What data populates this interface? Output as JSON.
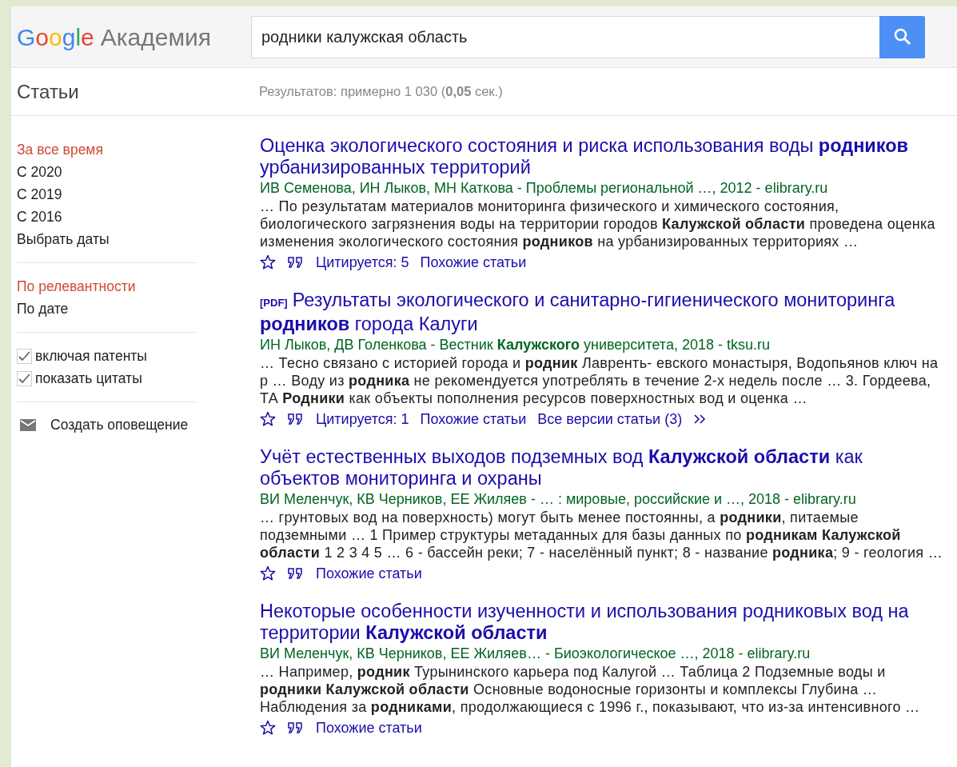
{
  "header": {
    "logo": "Google",
    "product": "Академия",
    "search": {
      "value": "родники калужская область"
    }
  },
  "section_title": "Статьи",
  "result_stats": "Результатов: примерно 1 030 (**0,05** сек.)",
  "sidebar": {
    "time_filters": [
      {
        "label": "За все время",
        "selected": true
      },
      {
        "label": "С 2020",
        "selected": false
      },
      {
        "label": "С 2019",
        "selected": false
      },
      {
        "label": "С 2016",
        "selected": false
      },
      {
        "label": "Выбрать даты",
        "selected": false
      }
    ],
    "sort": [
      {
        "label": "По релевантности",
        "selected": true
      },
      {
        "label": "По дате",
        "selected": false
      }
    ],
    "options": [
      {
        "label": "включая патенты",
        "checked": true
      },
      {
        "label": "показать цитаты",
        "checked": true
      }
    ],
    "alert": "Создать оповещение"
  },
  "results": [
    {
      "title": "Оценка экологического состояния и риска использования воды **родников** урбанизированных территорий",
      "authors": "ИВ Семенова, ИН Лыков, МН Каткова - Проблемы региональной …, 2012 - elibrary.ru",
      "snippet": "… По результатам материалов мониторинга физического и химического состояния, биологического загрязнения воды на территории городов **Калужской области** проведена оценка изменения экологического состояния **родников** на урбанизированных территориях …",
      "actions": [
        {
          "kind": "save"
        },
        {
          "kind": "cite"
        },
        {
          "kind": "link",
          "label": "Цитируется: 5"
        },
        {
          "kind": "link",
          "label": "Похожие статьи"
        }
      ]
    },
    {
      "tag": "[PDF]",
      "title": "Результаты экологического и санитарно-гигиенического мониторинга **родников** города Калуги",
      "authors": "ИН Лыков, ДВ Голенкова - Вестник **Калужского** университета, 2018 - tksu.ru",
      "snippet": "… Тесно связано с историей города и **родник** Лавренть- евского монастыря, Водопьянов ключ на р … Воду из **родника** не рекомендуется употреблять в течение 2-х недель после … 3. Гордеева, ТА **Родники** как объекты пополнения ресурсов поверхностных вод и оценка …",
      "actions": [
        {
          "kind": "save"
        },
        {
          "kind": "cite"
        },
        {
          "kind": "link",
          "label": "Цитируется: 1"
        },
        {
          "kind": "link",
          "label": "Похожие статьи"
        },
        {
          "kind": "link",
          "label": "Все версии статьи (3)"
        },
        {
          "kind": "more"
        }
      ]
    },
    {
      "title": "Учёт естественных выходов подземных вод **Калужской области** как объектов мониторинга и охраны",
      "authors": "ВИ Меленчук, КВ Черников, ЕЕ Жиляев - … : мировые, российские и …, 2018 - elibrary.ru",
      "snippet": "… грунтовых вод на поверхность) могут быть менее постоянны, а **родники**, питаемые подземными … 1 Пример структуры метаданных для базы данных по **родникам Калужской области** 1 2 3 4 5 … 6 - бассейн реки; 7 - населённый пункт; 8 - название **родника**; 9 - геология …",
      "actions": [
        {
          "kind": "save"
        },
        {
          "kind": "cite"
        },
        {
          "kind": "link",
          "label": "Похожие статьи"
        }
      ]
    },
    {
      "title": "Некоторые особенности изученности и использования родниковых вод на территории **Калужской области**",
      "authors": "ВИ Меленчук, КВ Черников, ЕЕ Жиляев… - Биоэкологическое …, 2018 - elibrary.ru",
      "snippet": "… Например, **родник** Турынинского карьера под Калугой … Таблица 2 Подземные воды и **родники** **Калужской области** Основные водоносные горизонты и комплексы Глубина … Наблюдения за **родниками**, продолжающиеся с 1996 г., показывают, что из-за интенсивного …",
      "actions": [
        {
          "kind": "save"
        },
        {
          "kind": "cite"
        },
        {
          "kind": "link",
          "label": "Похожие статьи"
        }
      ]
    }
  ]
}
